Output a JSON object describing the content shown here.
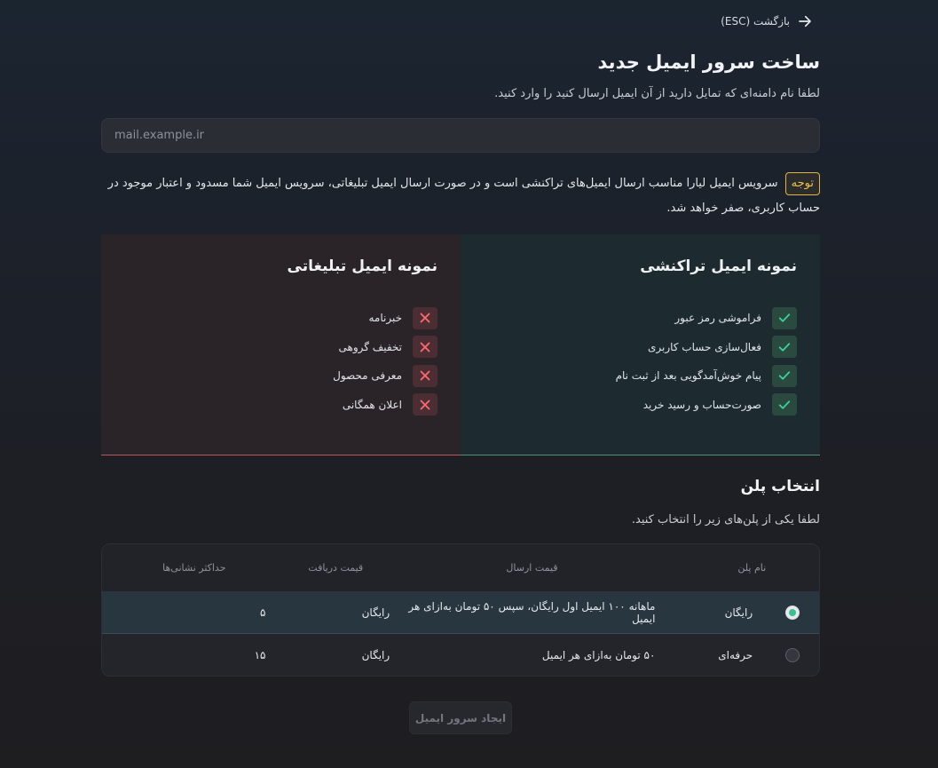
{
  "back": {
    "label": "بازگشت (ESC)"
  },
  "header": {
    "title": "ساخت سرور ایمیل جدید",
    "subtitle": "لطفا نام دامنه‌ای که تمایل دارید از آن ایمیل ارسال کنید را وارد کنید."
  },
  "domain": {
    "placeholder": "mail.example.ir",
    "value": ""
  },
  "notice": {
    "badge": "توجه",
    "text": "سرویس ایمیل لیارا مناسب ارسال ایمیل‌های تراکنشی است و در صورت ارسال ایمیل تبلیغاتی، سرویس ایمیل شما مسدود و اعتبار موجود در حساب کاربری، صفر خواهد شد."
  },
  "transactional": {
    "title": "نمونه ایمیل تراکنشی",
    "items": [
      "فراموشی رمز عبور",
      "فعال‌سازی حساب کاربری",
      "پیام خوش‌آمدگویی بعد از ثبت نام",
      "صورت‌حساب و رسید خرید"
    ],
    "accent": "#4f8f73"
  },
  "promotional": {
    "title": "نمونه ایمیل تبلیغاتی",
    "items": [
      "خبرنامه",
      "تخفیف گروهی",
      "معرفی محصول",
      "اعلان همگانی"
    ],
    "accent": "#b85a5a"
  },
  "plans": {
    "title": "انتخاب پلن",
    "subtitle": "لطفا یکی از پلن‌های زیر را انتخاب کنید.",
    "headers": {
      "name": "نام پلن",
      "send_price": "قیمت ارسال",
      "receive_price": "قیمت دریافت",
      "max_addresses": "حداکثر نشانی‌ها"
    },
    "rows": [
      {
        "name": "رایگان",
        "send_price": "ماهانه ۱۰۰ ایمیل اول رایگان، سپس ۵۰ تومان به‌ازای هر ایمیل",
        "receive_price": "رایگان",
        "max_addresses": "۵",
        "selected": true
      },
      {
        "name": "حرفه‌ای",
        "send_price": "۵۰ تومان به‌ازای هر ایمیل",
        "receive_price": "رایگان",
        "max_addresses": "۱۵",
        "selected": false
      }
    ]
  },
  "submit": {
    "label": "ایجاد سرور ایمیل",
    "disabled": true
  },
  "colors": {
    "success": "#35c28d",
    "warning": "#f0c24c",
    "danger": "#e06a6a"
  }
}
